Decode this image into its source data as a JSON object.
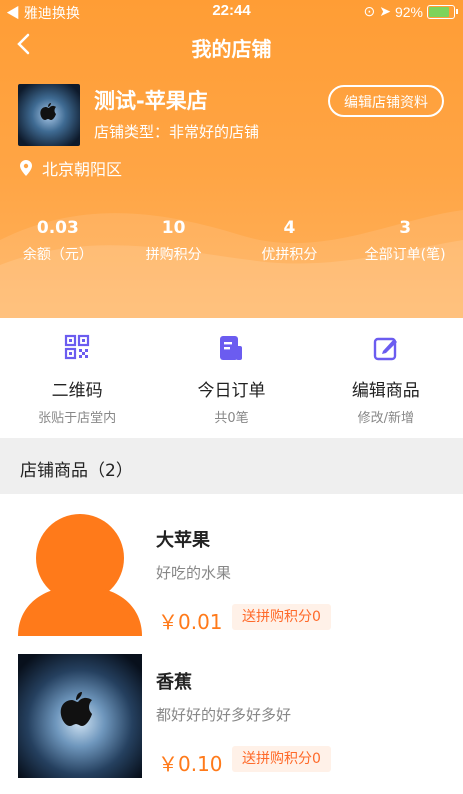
{
  "status_bar": {
    "carrier": "◀ 雅迪换换",
    "time": "22:44",
    "battery_pct": "92%"
  },
  "header": {
    "title": "我的店铺",
    "back_icon": "chevron-left-icon"
  },
  "shop": {
    "name": "测试-苹果店",
    "type": "店铺类型：非常好的店铺",
    "edit_label": "编辑店铺资料",
    "location": "北京朝阳区"
  },
  "stats": [
    {
      "value": "0.03",
      "label": "余额（元）"
    },
    {
      "value": "10",
      "label": "拼购积分"
    },
    {
      "value": "4",
      "label": "优拼积分"
    },
    {
      "value": "3",
      "label": "全部订单(笔)"
    }
  ],
  "actions": [
    {
      "title": "二维码",
      "sub": "张贴于店堂内",
      "icon": "qrcode-icon"
    },
    {
      "title": "今日订单",
      "sub": "共0笔",
      "icon": "order-icon"
    },
    {
      "title": "编辑商品",
      "sub": "修改/新增",
      "icon": "edit-icon"
    }
  ],
  "section": {
    "title": "店铺商品（2）"
  },
  "products": [
    {
      "name": "大苹果",
      "desc": "好吃的水果",
      "price": "￥0.01",
      "badge": "送拼购积分0",
      "image": "avatar-placeholder"
    },
    {
      "name": "香蕉",
      "desc": "都好好的好多好多好",
      "price": "￥0.10",
      "badge": "送拼购积分0",
      "image": "apple-logo-image"
    }
  ],
  "colors": {
    "brand": "#ff9d35",
    "price": "#ff7a1a",
    "icon": "#6b5cf0"
  }
}
